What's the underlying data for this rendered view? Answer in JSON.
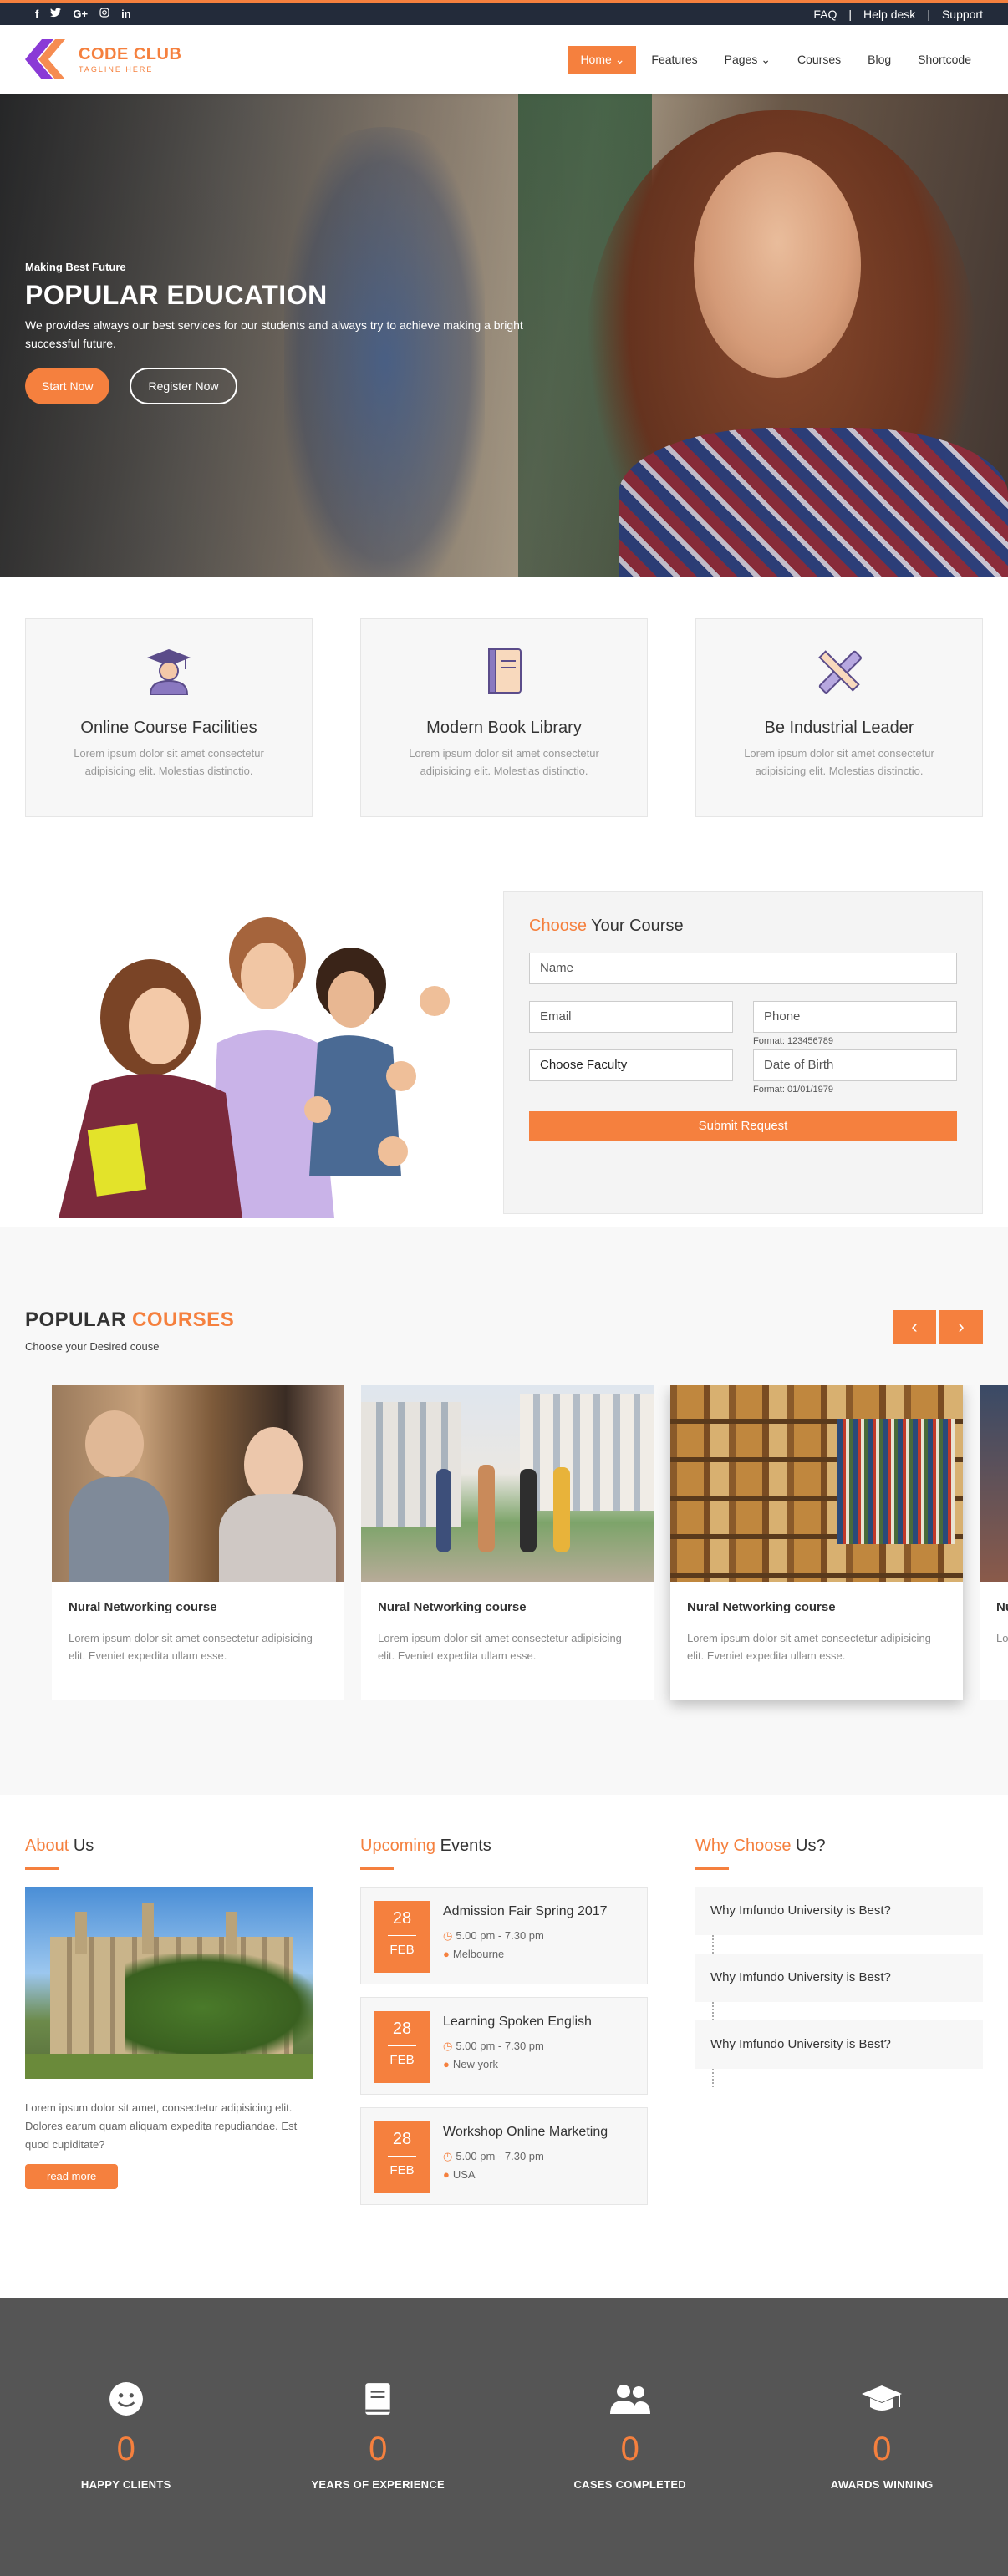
{
  "topbar": {
    "social": [
      "f",
      "t",
      "G+",
      "ig",
      "in"
    ],
    "links": [
      "FAQ",
      "Help desk",
      "Support"
    ]
  },
  "brand": {
    "name": "CODE CLUB",
    "tagline": "TAGLINE HERE"
  },
  "nav": {
    "items": [
      "Home",
      "Features",
      "Pages",
      "Courses",
      "Blog",
      "Shortcode"
    ]
  },
  "hero": {
    "kicker": "Making Best Future",
    "title": "POPULAR EDUCATION",
    "text": "We provides always our best services for our students and always try to achieve making a bright successful future.",
    "btn_primary": "Start Now",
    "btn_secondary": "Register Now"
  },
  "features": [
    {
      "title": "Online Course Facilities",
      "text": "Lorem ipsum dolor sit amet consectetur adipisicing elit. Molestias distinctio."
    },
    {
      "title": "Modern Book Library",
      "text": "Lorem ipsum dolor sit amet consectetur adipisicing elit. Molestias distinctio."
    },
    {
      "title": "Be Industrial Leader",
      "text": "Lorem ipsum dolor sit amet consectetur adipisicing elit. Molestias distinctio."
    }
  ],
  "course_form": {
    "title_accent": "Choose",
    "title_rest": " Your Course",
    "name_ph": "Name",
    "email_ph": "Email",
    "phone_ph": "Phone",
    "phone_fmt": "Format: 123456789",
    "faculty": "Choose Faculty",
    "dob_ph": "Date of Birth",
    "dob_fmt": "Format: 01/01/1979",
    "submit": "Submit Request"
  },
  "popular": {
    "title_main": "POPULAR",
    "title_accent": " COURSES",
    "subtitle": "Choose your Desired couse",
    "cards": [
      {
        "title": "Nural Networking course",
        "text": "Lorem ipsum dolor sit amet consectetur adipisicing elit. Eveniet expedita ullam esse."
      },
      {
        "title": "Nural Networking course",
        "text": "Lorem ipsum dolor sit amet consectetur adipisicing elit. Eveniet expedita ullam esse."
      },
      {
        "title": "Nural Networking course",
        "text": "Lorem ipsum dolor sit amet consectetur adipisicing elit. Eveniet expedita ullam esse."
      },
      {
        "title": "Nu",
        "text": "Lo"
      }
    ]
  },
  "about": {
    "title_accent": "About",
    "title_rest": " Us",
    "text": "Lorem ipsum dolor sit amet, consectetur adipisicing elit. Dolores earum quam aliquam expedita repudiandae. Est quod cupiditate?",
    "btn": "read more"
  },
  "events": {
    "title_accent": "Upcoming",
    "title_rest": " Events",
    "items": [
      {
        "day": "28",
        "month": "FEB",
        "title": "Admission Fair Spring 2017",
        "time": "5.00 pm - 7.30 pm",
        "place": "Melbourne"
      },
      {
        "day": "28",
        "month": "FEB",
        "title": "Learning Spoken English",
        "time": "5.00 pm - 7.30 pm",
        "place": "New york"
      },
      {
        "day": "28",
        "month": "FEB",
        "title": "Workshop Online Marketing",
        "time": "5.00 pm - 7.30 pm",
        "place": "USA"
      }
    ]
  },
  "why": {
    "title_accent": "Why Choose",
    "title_rest": " Us?",
    "items": [
      "Why Imfundo University is Best?",
      "Why Imfundo University is Best?",
      "Why Imfundo University is Best?"
    ]
  },
  "stats": [
    {
      "icon": "smile-icon",
      "num": "0",
      "label": "HAPPY CLIENTS"
    },
    {
      "icon": "book-icon",
      "num": "0",
      "label": "YEARS OF EXPERIENCE"
    },
    {
      "icon": "users-icon",
      "num": "0",
      "label": "CASES COMPLETED"
    },
    {
      "icon": "graduation-cap-icon",
      "num": "0",
      "label": "AWARDS WINNING"
    }
  ],
  "colors": {
    "accent": "#f5803e",
    "dark": "#232b3a",
    "stats_bg": "#555555"
  }
}
